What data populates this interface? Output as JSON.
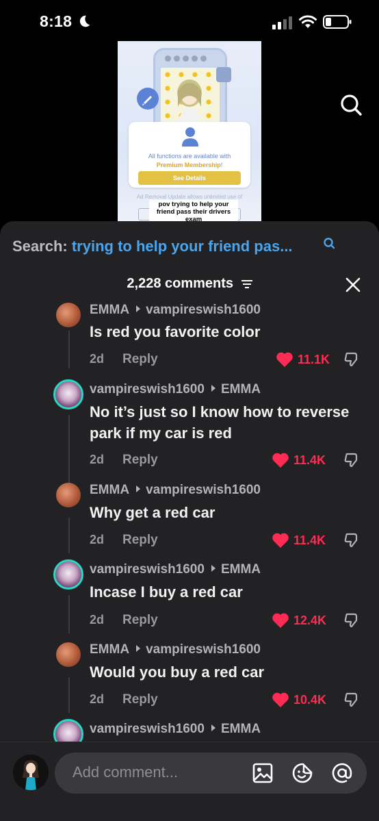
{
  "status_bar": {
    "time": "8:18",
    "dnd_icon": "moon-icon"
  },
  "video": {
    "caption": "pov trying to help your friend pass their drivers exam",
    "card_text_line1": "All functions are available with",
    "card_text_premium": "Premium Membership",
    "card_text_suffix": "!",
    "see_details": "See Details",
    "ad_text": "Ad Removal Update allows unlimited use of brush",
    "about_text": "About the Ad Removal Update"
  },
  "search": {
    "prefix": "Search:",
    "query": "trying to help your friend pas..."
  },
  "comments_header": {
    "count_label": "2,228 comments"
  },
  "comments": [
    {
      "author": "EMMA",
      "reply_to": "vampireswish1600",
      "text": "Is red you favorite color",
      "date": "2d",
      "reply": "Reply",
      "likes": "11.1K",
      "avatar": "emma"
    },
    {
      "author": "vampireswish1600",
      "reply_to": "EMMA",
      "text": "No it’s just so I know how to reverse park if my car is red",
      "date": "2d",
      "reply": "Reply",
      "likes": "11.4K",
      "avatar": "vamp"
    },
    {
      "author": "EMMA",
      "reply_to": "vampireswish1600",
      "text": "Why get a red car",
      "date": "2d",
      "reply": "Reply",
      "likes": "11.4K",
      "avatar": "emma"
    },
    {
      "author": "vampireswish1600",
      "reply_to": "EMMA",
      "text": "Incase I buy a red car",
      "date": "2d",
      "reply": "Reply",
      "likes": "12.4K",
      "avatar": "vamp"
    },
    {
      "author": "EMMA",
      "reply_to": "vampireswish1600",
      "text": "Would you buy a red car",
      "date": "2d",
      "reply": "Reply",
      "likes": "10.4K",
      "avatar": "emma"
    },
    {
      "author": "vampireswish1600",
      "reply_to": "EMMA",
      "text": "",
      "date": "",
      "reply": "",
      "likes": "",
      "avatar": "vamp"
    }
  ],
  "input": {
    "placeholder": "Add comment..."
  },
  "colors": {
    "like": "#fe2c55",
    "link": "#4aa5ee",
    "sheet": "#222224"
  }
}
